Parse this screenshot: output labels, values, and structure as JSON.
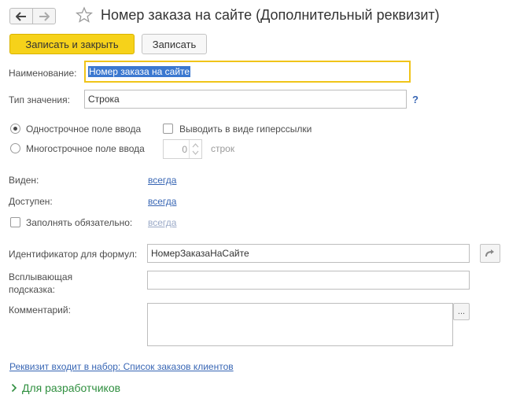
{
  "window": {
    "title": "Номер заказа на сайте (Дополнительный реквизит)"
  },
  "icons": {
    "back": "arrow-left-icon",
    "forward": "arrow-right-icon",
    "favorite": "star-icon",
    "generate_id": "curved-arrow-icon",
    "select_more": "ellipsis-icon",
    "expand": "chevron-right-icon"
  },
  "toolbar": {
    "save_close_label": "Записать и закрыть",
    "save_label": "Записать"
  },
  "form": {
    "name_label": "Наименование:",
    "name_value": "Номер заказа на сайте",
    "type_label": "Тип значения:",
    "type_value": "Строка",
    "type_help": "?",
    "single_line_label": "Однострочное поле ввода",
    "multi_line_label": "Многострочное поле ввода",
    "hyperlink_label": "Выводить в виде гиперссылки",
    "lines_value": "0",
    "lines_unit": "строк",
    "visible_label": "Виден:",
    "visible_value": "всегда",
    "available_label": "Доступен:",
    "available_value": "всегда",
    "required_label": "Заполнять обязательно:",
    "required_value": "всегда",
    "formula_id_label": "Идентификатор для формул:",
    "formula_id_value": "НомерЗаказаНаСайте",
    "tooltip_label_line1": "Всплывающая",
    "tooltip_label_line2": "подсказка:",
    "tooltip_value": "",
    "comment_label": "Комментарий:",
    "comment_value": "",
    "comment_more": "..."
  },
  "footer": {
    "set_link": "Реквизит входит в набор: Список заказов клиентов",
    "developers_label": "Для разработчиков"
  },
  "colors": {
    "primary_button": "#f6d21a",
    "focus_border": "#f0c419",
    "link": "#3866b4",
    "developers": "#2f8f3f",
    "selection": "#3b78d0"
  }
}
